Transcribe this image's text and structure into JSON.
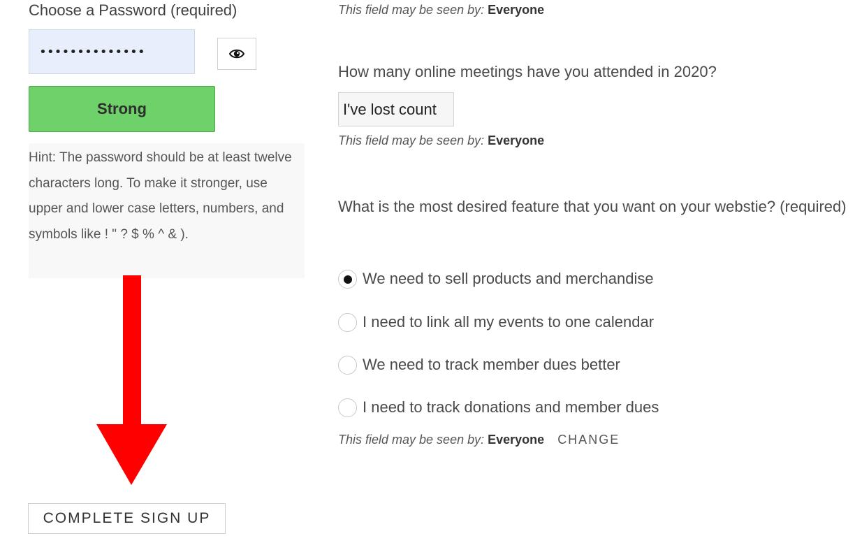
{
  "password": {
    "label": "Choose a Password (required)",
    "value": "••••••••••••••",
    "toggle_icon": "eye-icon",
    "strength": "Strong",
    "strength_color": "#6fd16a",
    "hint": "Hint: The password should be at least twelve characters long. To make it stronger, use upper and lower case letters, numbers, and symbols like ! \" ? $ % ^ & )."
  },
  "signup": {
    "button_label": "COMPLETE SIGN UP"
  },
  "visibility": {
    "prefix": "This field may be seen by:",
    "value": "Everyone",
    "change_label": "CHANGE"
  },
  "meetings": {
    "question": "How many online meetings have you attended in 2020?",
    "value": "I've lost count"
  },
  "feature": {
    "question": "What is the most desired feature that you want on your webstie? (required)",
    "options": [
      {
        "label": "We need to sell products and merchandise",
        "checked": true
      },
      {
        "label": "I need to link all my events to one calendar",
        "checked": false
      },
      {
        "label": "We need to track member dues better",
        "checked": false
      },
      {
        "label": "I need to track donations and member dues",
        "checked": false
      }
    ]
  },
  "annotation": {
    "arrow_color": "#ff0000",
    "arrow_icon": "arrow-down-icon"
  }
}
